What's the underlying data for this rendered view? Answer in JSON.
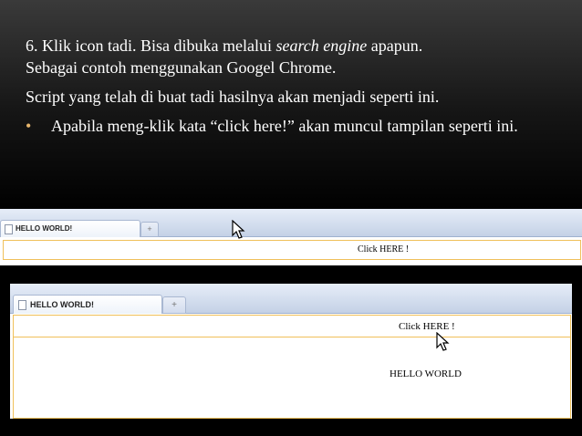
{
  "slide": {
    "step_prefix": "6. Klik icon tadi. Bisa dibuka melalui ",
    "step_em": "search engine",
    "step_suffix": " apapun.",
    "step_line2": "Sebagai contoh menggunakan Googel Chrome.",
    "para2": "Script yang telah di buat tadi hasilnya akan menjadi seperti ini.",
    "bullet_char": "•",
    "bullet_text": "Apabila meng-klik kata “click here!” akan muncul tampilan seperti ini."
  },
  "screenshot1": {
    "tab_title": "HELLO WORLD!",
    "new_tab_symbol": "+",
    "link_text": "Click HERE !"
  },
  "screenshot2": {
    "tab_title": "HELLO WORLD!",
    "new_tab_symbol": "+",
    "link_text": "Click HERE !",
    "result_text": "HELLO WORLD"
  },
  "colors": {
    "bullet": "#e8b66c",
    "frame_border": "#f0c05a",
    "tab_border": "#a9b8d2"
  }
}
